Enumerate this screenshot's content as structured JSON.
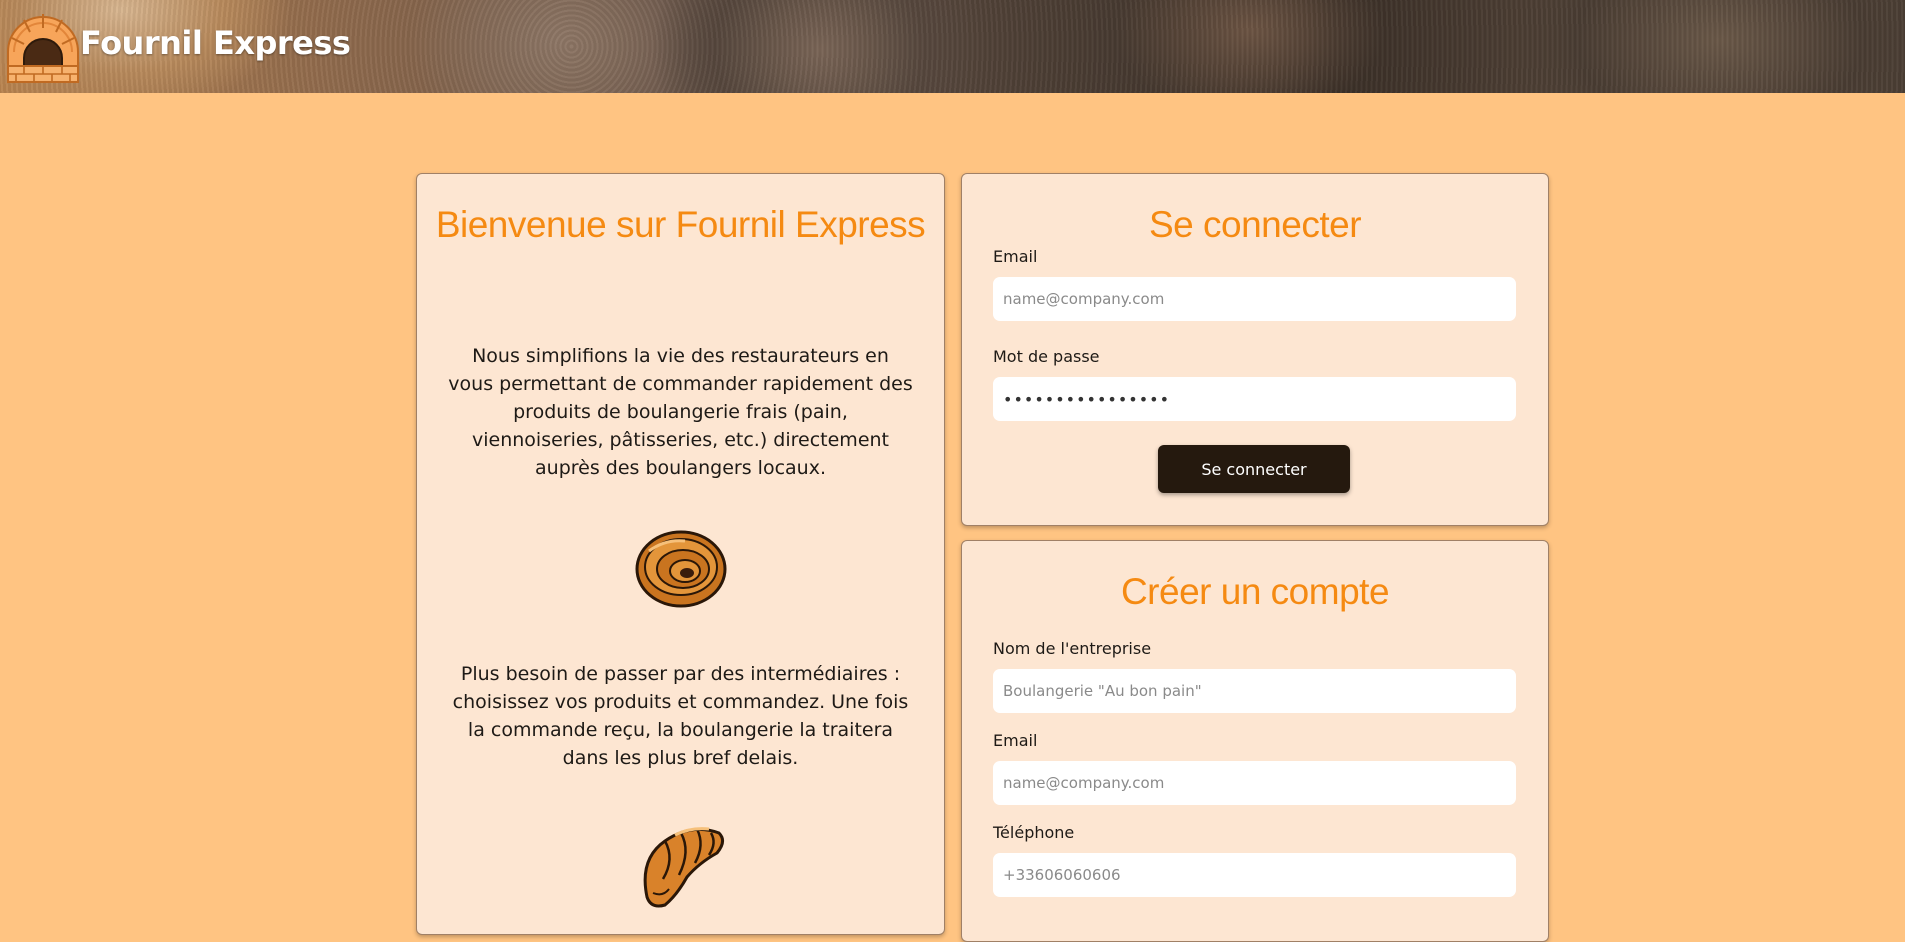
{
  "header": {
    "brand": "Fournil Express",
    "logo_icon": "bread-oven-icon"
  },
  "welcome": {
    "title": "Bienvenue sur Fournil Express",
    "paragraph1": "Nous simplifions la vie des restaurateurs en vous permettant de commander rapidement des produits de boulangerie frais (pain, viennoiseries, pâtisseries, etc.) directement auprès des boulangers locaux.",
    "paragraph2": "Plus besoin de passer par des intermédiaires : choisissez vos produits et commandez. Une fois la commande reçu, la boulangerie la traitera dans les plus bref delais.",
    "image1": "pain-au-chocolat-icon",
    "image2": "croissant-icon"
  },
  "login": {
    "title": "Se connecter",
    "email_label": "Email",
    "email_placeholder": "name@company.com",
    "password_label": "Mot de passe",
    "password_value": "••••••••••••••••",
    "submit_label": "Se connecter"
  },
  "register": {
    "title": "Créer un compte",
    "company_label": "Nom de l'entreprise",
    "company_placeholder": "Boulangerie \"Au bon pain\"",
    "email_label": "Email",
    "email_placeholder": "name@company.com",
    "phone_label": "Téléphone",
    "phone_placeholder": "+33606060606"
  },
  "colors": {
    "page_background": "#ffc482",
    "card_background": "#fde6d2",
    "accent_orange": "#f58a12",
    "button_dark": "#25190e"
  }
}
